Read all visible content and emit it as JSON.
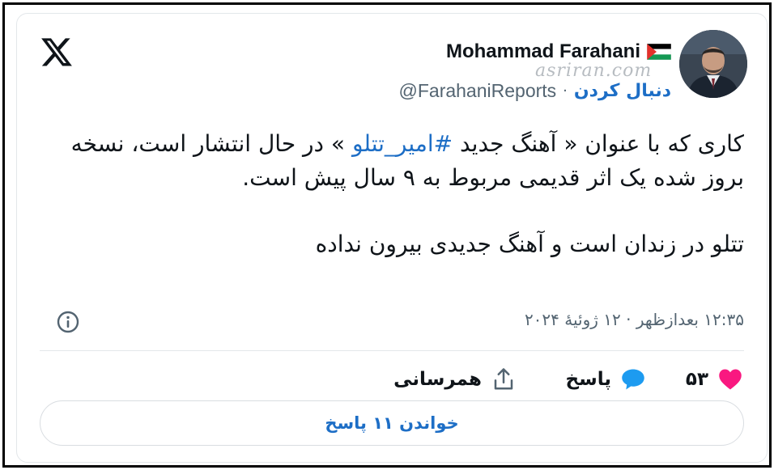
{
  "header": {
    "display_name": "Mohammad Farahani",
    "handle": "@FarahaniReports",
    "separator": "·",
    "follow_label": "دنبال کردن",
    "watermark": "asriran.com"
  },
  "tweet": {
    "line1_before": "کاری که با عنوان « آهنگ جدید ",
    "hashtag": "#امیر_تتلو",
    "line1_after": " » در حال انتشار است، نسخه بروز شده یک اثر قدیمی مربوط به ۹ سال پیش است.",
    "paragraph2": "تتلو در زندان است و آهنگ جدیدی بیرون نداده",
    "timestamp": "۱۲:۳۵ بعدازظهر · ۱۲ ژوئیهٔ ۲۰۲۴"
  },
  "actions": {
    "like_count": "۵۳",
    "reply_label": "پاسخ",
    "share_label": "همرسانی"
  },
  "footer": {
    "read_replies_label": "خواندن ۱۱ پاسخ"
  },
  "colors": {
    "accent": "#1d6ec6",
    "like": "#f91880",
    "reply": "#1d9bf0",
    "muted": "#536471"
  },
  "icons": [
    "x-logo-icon",
    "palestine-flag-icon",
    "avatar",
    "info-icon",
    "heart-icon",
    "reply-bubble-icon",
    "share-icon"
  ]
}
